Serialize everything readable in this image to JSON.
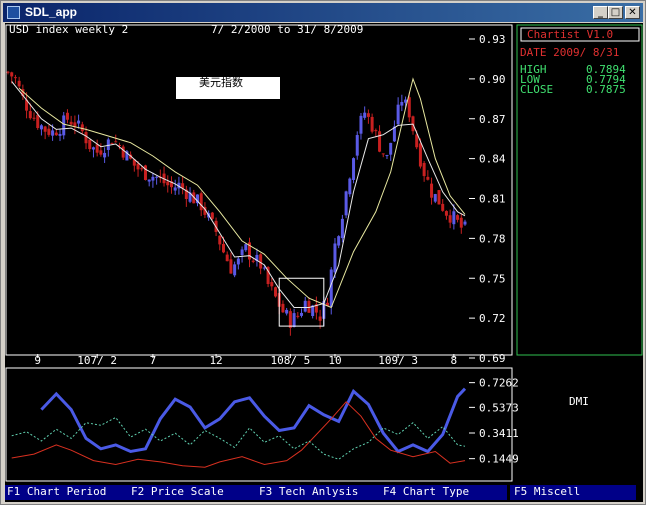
{
  "window": {
    "title": "SDL_app"
  },
  "chart_header": {
    "symbol": "USD index weekly 2",
    "range": "7/ 2/2000 to 31/ 8/2009"
  },
  "annotation_label": "美元指数",
  "info_panel": {
    "name": "Chartist V1.0",
    "date_label": "DATE 2009/ 8/31",
    "high_label": "HIGH",
    "high_value": "0.7894",
    "low_label": "LOW",
    "low_value": "0.7794",
    "close_label": "CLOSE",
    "close_value": "0.7875"
  },
  "indicator_label": "DMI",
  "function_keys": [
    {
      "label": "F1 Chart Period"
    },
    {
      "label": "F2 Price Scale"
    },
    {
      "label": "F3 Tech Anlysis"
    },
    {
      "label": "F4 Chart Type"
    },
    {
      "label": "F5 Miscell"
    }
  ],
  "colors": {
    "bull": "#5a5ae6",
    "bear": "#c82020",
    "ma_fast": "#e8e8e8",
    "ma_slow": "#e8e8a0",
    "dmi_main": "#4a5ae6",
    "dmi_plus": "#d83020",
    "dmi_minus": "#60d0b0",
    "panel_text": "#40e070",
    "panel_border": "#30c050",
    "fkey_bar": "#000088"
  },
  "chart_data": [
    {
      "type": "candlestick",
      "y_tick_labels": [
        "0.93",
        "0.90",
        "0.87",
        "0.84",
        "0.81",
        "0.78",
        "0.75",
        "0.72",
        "0.69"
      ],
      "y_ticks": [
        0.93,
        0.9,
        0.87,
        0.84,
        0.81,
        0.78,
        0.75,
        0.72,
        0.69
      ],
      "ylim": [
        0.69,
        0.93
      ],
      "x_tick_labels": [
        "9",
        "107/ 2",
        "7",
        "12",
        "108/ 5",
        "10",
        "109/ 3",
        "8"
      ],
      "x_ticks": [
        9,
        25,
        40,
        57,
        77,
        89,
        106,
        121
      ],
      "xlim": [
        1,
        124
      ],
      "close_path": [
        [
          1,
          0.905
        ],
        [
          3,
          0.9
        ],
        [
          5,
          0.885
        ],
        [
          7,
          0.875
        ],
        [
          9,
          0.867
        ],
        [
          11,
          0.862
        ],
        [
          13,
          0.86
        ],
        [
          15,
          0.864
        ],
        [
          17,
          0.87
        ],
        [
          19,
          0.867
        ],
        [
          21,
          0.86
        ],
        [
          23,
          0.85
        ],
        [
          25,
          0.845
        ],
        [
          27,
          0.85
        ],
        [
          29,
          0.855
        ],
        [
          31,
          0.85
        ],
        [
          33,
          0.842
        ],
        [
          35,
          0.835
        ],
        [
          37,
          0.83
        ],
        [
          39,
          0.828
        ],
        [
          41,
          0.826
        ],
        [
          43,
          0.822
        ],
        [
          45,
          0.818
        ],
        [
          47,
          0.82
        ],
        [
          49,
          0.815
        ],
        [
          51,
          0.81
        ],
        [
          53,
          0.805
        ],
        [
          55,
          0.795
        ],
        [
          57,
          0.785
        ],
        [
          59,
          0.77
        ],
        [
          61,
          0.758
        ],
        [
          63,
          0.762
        ],
        [
          65,
          0.772
        ],
        [
          67,
          0.765
        ],
        [
          69,
          0.76
        ],
        [
          71,
          0.745
        ],
        [
          73,
          0.735
        ],
        [
          75,
          0.725
        ],
        [
          77,
          0.718
        ],
        [
          79,
          0.722
        ],
        [
          81,
          0.732
        ],
        [
          83,
          0.728
        ],
        [
          85,
          0.722
        ],
        [
          87,
          0.735
        ],
        [
          89,
          0.775
        ],
        [
          91,
          0.8
        ],
        [
          93,
          0.83
        ],
        [
          95,
          0.86
        ],
        [
          97,
          0.875
        ],
        [
          99,
          0.865
        ],
        [
          101,
          0.85
        ],
        [
          103,
          0.84
        ],
        [
          105,
          0.865
        ],
        [
          107,
          0.885
        ],
        [
          109,
          0.875
        ],
        [
          111,
          0.85
        ],
        [
          113,
          0.83
        ],
        [
          115,
          0.815
        ],
        [
          117,
          0.808
        ],
        [
          119,
          0.8
        ],
        [
          121,
          0.795
        ],
        [
          123,
          0.788
        ],
        [
          124,
          0.787
        ]
      ],
      "ma_fast": [
        [
          2,
          0.898
        ],
        [
          6,
          0.884
        ],
        [
          10,
          0.87
        ],
        [
          14,
          0.862
        ],
        [
          18,
          0.863
        ],
        [
          22,
          0.857
        ],
        [
          26,
          0.849
        ],
        [
          30,
          0.851
        ],
        [
          34,
          0.842
        ],
        [
          38,
          0.832
        ],
        [
          42,
          0.826
        ],
        [
          46,
          0.821
        ],
        [
          50,
          0.814
        ],
        [
          54,
          0.802
        ],
        [
          58,
          0.784
        ],
        [
          62,
          0.766
        ],
        [
          66,
          0.767
        ],
        [
          70,
          0.76
        ],
        [
          74,
          0.742
        ],
        [
          78,
          0.728
        ],
        [
          82,
          0.728
        ],
        [
          86,
          0.731
        ],
        [
          90,
          0.76
        ],
        [
          94,
          0.815
        ],
        [
          98,
          0.855
        ],
        [
          102,
          0.858
        ],
        [
          106,
          0.865
        ],
        [
          110,
          0.866
        ],
        [
          114,
          0.84
        ],
        [
          118,
          0.815
        ],
        [
          122,
          0.8
        ],
        [
          124,
          0.797
        ]
      ],
      "ma_slow": [
        [
          4,
          0.893
        ],
        [
          10,
          0.878
        ],
        [
          16,
          0.866
        ],
        [
          22,
          0.862
        ],
        [
          28,
          0.857
        ],
        [
          34,
          0.852
        ],
        [
          40,
          0.842
        ],
        [
          46,
          0.83
        ],
        [
          52,
          0.82
        ],
        [
          58,
          0.8
        ],
        [
          64,
          0.778
        ],
        [
          70,
          0.768
        ],
        [
          76,
          0.75
        ],
        [
          82,
          0.735
        ],
        [
          88,
          0.728
        ],
        [
          94,
          0.77
        ],
        [
          100,
          0.8
        ],
        [
          104,
          0.83
        ],
        [
          108,
          0.878
        ],
        [
          110,
          0.9
        ],
        [
          112,
          0.885
        ],
        [
          116,
          0.84
        ],
        [
          120,
          0.812
        ],
        [
          124,
          0.798
        ]
      ],
      "highlight_box": {
        "x": [
          74,
          86
        ],
        "y": [
          0.714,
          0.75
        ]
      },
      "annotation_text": "美元指数"
    },
    {
      "type": "line",
      "title": "DMI",
      "y_tick_labels": [
        "0.7262",
        "0.5373",
        "0.3411",
        "0.1449"
      ],
      "y_ticks": [
        0.7262,
        0.5373,
        0.3411,
        0.1449
      ],
      "ylim": [
        0.02,
        0.8
      ],
      "xlim": [
        1,
        124
      ],
      "series": [
        {
          "values": [
            [
              10,
              0.52
            ],
            [
              14,
              0.64
            ],
            [
              18,
              0.52
            ],
            [
              22,
              0.3
            ],
            [
              26,
              0.22
            ],
            [
              30,
              0.25
            ],
            [
              34,
              0.2
            ],
            [
              38,
              0.22
            ],
            [
              42,
              0.45
            ],
            [
              46,
              0.6
            ],
            [
              50,
              0.54
            ],
            [
              54,
              0.38
            ],
            [
              58,
              0.45
            ],
            [
              62,
              0.58
            ],
            [
              66,
              0.61
            ],
            [
              70,
              0.47
            ],
            [
              74,
              0.36
            ],
            [
              78,
              0.38
            ],
            [
              82,
              0.55
            ],
            [
              86,
              0.48
            ],
            [
              90,
              0.43
            ],
            [
              94,
              0.66
            ],
            [
              98,
              0.56
            ],
            [
              102,
              0.34
            ],
            [
              106,
              0.2
            ],
            [
              110,
              0.25
            ],
            [
              114,
              0.2
            ],
            [
              118,
              0.33
            ],
            [
              122,
              0.62
            ],
            [
              124,
              0.68
            ]
          ]
        },
        {
          "values": [
            [
              2,
              0.15
            ],
            [
              8,
              0.18
            ],
            [
              14,
              0.25
            ],
            [
              18,
              0.21
            ],
            [
              24,
              0.13
            ],
            [
              30,
              0.1
            ],
            [
              36,
              0.14
            ],
            [
              42,
              0.12
            ],
            [
              48,
              0.09
            ],
            [
              54,
              0.08
            ],
            [
              58,
              0.12
            ],
            [
              64,
              0.16
            ],
            [
              70,
              0.1
            ],
            [
              76,
              0.13
            ],
            [
              80,
              0.21
            ],
            [
              84,
              0.33
            ],
            [
              88,
              0.45
            ],
            [
              92,
              0.58
            ],
            [
              96,
              0.47
            ],
            [
              100,
              0.3
            ],
            [
              104,
              0.21
            ],
            [
              110,
              0.16
            ],
            [
              116,
              0.2
            ],
            [
              120,
              0.11
            ],
            [
              124,
              0.13
            ]
          ]
        },
        {
          "values": [
            [
              2,
              0.32
            ],
            [
              6,
              0.35
            ],
            [
              10,
              0.28
            ],
            [
              14,
              0.37
            ],
            [
              18,
              0.3
            ],
            [
              22,
              0.42
            ],
            [
              26,
              0.4
            ],
            [
              30,
              0.46
            ],
            [
              34,
              0.31
            ],
            [
              38,
              0.37
            ],
            [
              42,
              0.28
            ],
            [
              46,
              0.34
            ],
            [
              50,
              0.25
            ],
            [
              54,
              0.36
            ],
            [
              58,
              0.3
            ],
            [
              62,
              0.23
            ],
            [
              66,
              0.38
            ],
            [
              70,
              0.27
            ],
            [
              74,
              0.32
            ],
            [
              78,
              0.22
            ],
            [
              82,
              0.28
            ],
            [
              86,
              0.18
            ],
            [
              90,
              0.14
            ],
            [
              94,
              0.22
            ],
            [
              98,
              0.27
            ],
            [
              102,
              0.38
            ],
            [
              106,
              0.33
            ],
            [
              110,
              0.42
            ],
            [
              114,
              0.3
            ],
            [
              118,
              0.39
            ],
            [
              122,
              0.25
            ],
            [
              124,
              0.24
            ]
          ]
        }
      ]
    }
  ]
}
